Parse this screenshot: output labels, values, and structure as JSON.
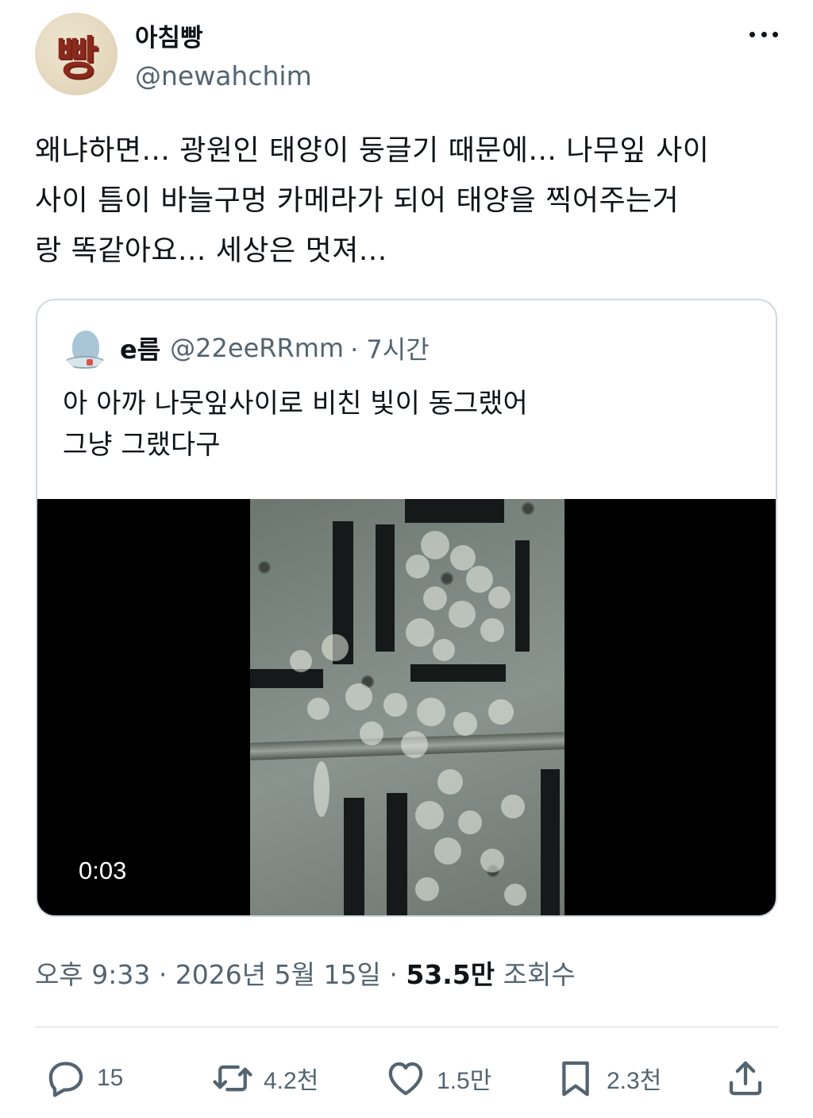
{
  "author": {
    "display_name": "아침빵",
    "handle": "@newahchim",
    "avatar_text": "빵"
  },
  "tweet": {
    "text_lines": [
      "왜냐하면... 광원인 태양이 둥글기 때문에... 나무잎 사이",
      "사이 틈이 바늘구멍 카메라가 되어 태양을 찍어주는거",
      "랑 똑같아요... 세상은 멋져..."
    ]
  },
  "quote": {
    "display_name": "e름",
    "handle": "@22eeRRmm",
    "time": "· 7시간",
    "text_lines": [
      "아 아까 나뭇잎사이로 비친 빛이 동그랬어",
      "그냥 그랬다구"
    ],
    "video_duration": "0:03"
  },
  "meta": {
    "time": "오후 9:33",
    "date": "· 2026년 5월 15일 ·",
    "views_count": "53.5만",
    "views_label": "조회수"
  },
  "actions": {
    "replies": "15",
    "retweets": "4.2천",
    "likes": "1.5만",
    "bookmarks": "2.3천"
  },
  "icons": [
    "more-icon",
    "reply-icon",
    "retweet-icon",
    "like-icon",
    "bookmark-icon",
    "share-icon"
  ],
  "colors": {
    "text_primary": "#0f1419",
    "text_secondary": "#536471",
    "border": "#cfd9de",
    "video_bg": "#000000"
  }
}
